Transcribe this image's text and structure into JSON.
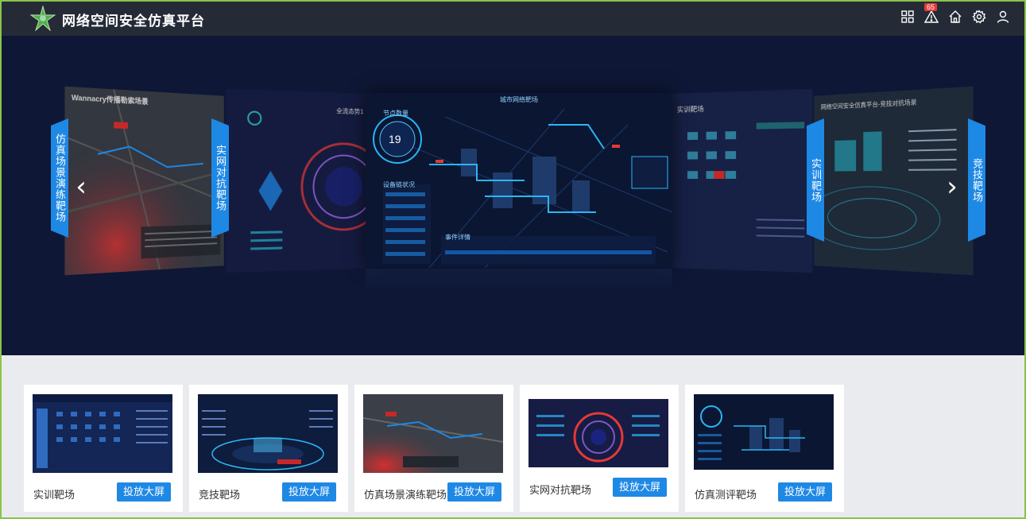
{
  "header": {
    "title": "网络空间安全仿真平台",
    "alert_count": "65",
    "icons": [
      "grid-icon",
      "warning-icon",
      "home-icon",
      "gear-icon",
      "user-icon"
    ]
  },
  "carousel": {
    "tabs": {
      "left_outer": "仿真场景演练靶场",
      "left_inner": "实网对抗靶场",
      "right_inner": "实训靶场",
      "right_outer": "竞技靶场"
    },
    "panels": {
      "far_left_title": "Wannacry传播勒索场景",
      "left_title": "全流态势1",
      "center_title": "城市网络靶场",
      "center_nodes_label": "节点数量",
      "center_nodes_value": "19",
      "center_device_label": "设备链状况",
      "center_events_label": "事件详情",
      "right_title": "实训靶场",
      "far_right_title": "网络空间安全仿真平台-竞技对抗场景"
    },
    "prev_arrow": "‹",
    "next_arrow": "›"
  },
  "cards": [
    {
      "label": "实训靶场",
      "button": "投放大屏"
    },
    {
      "label": "竞技靶场",
      "button": "投放大屏"
    },
    {
      "label": "仿真场景演练靶场",
      "button": "投放大屏"
    },
    {
      "label": "实网对抗靶场",
      "button": "投放大屏"
    },
    {
      "label": "仿真测评靶场",
      "button": "投放大屏"
    }
  ],
  "colors": {
    "header_bg": "#252b36",
    "hero_bg": "#0e1735",
    "accent": "#1e88e5",
    "badge": "#e53935"
  }
}
